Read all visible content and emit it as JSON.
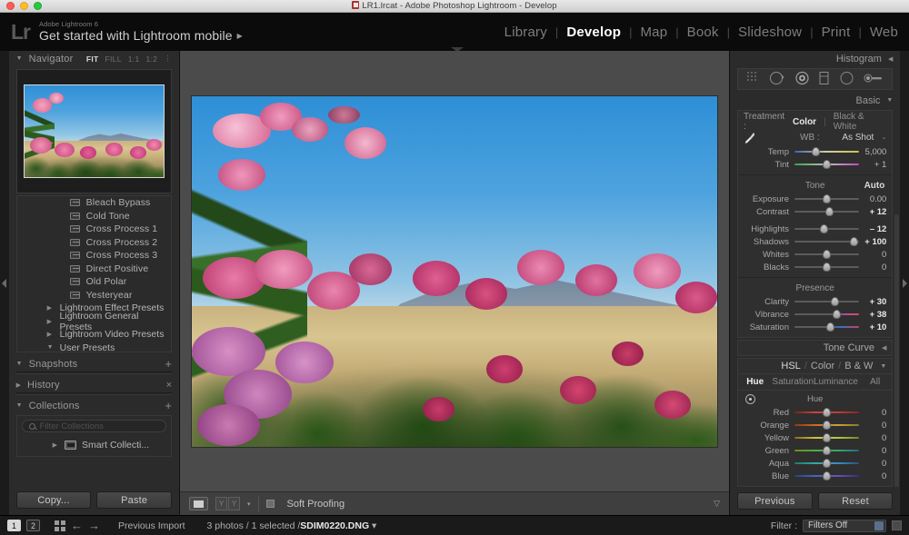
{
  "window": {
    "title": "LR1.lrcat - Adobe Photoshop Lightroom - Develop",
    "icon": "catalog-icon"
  },
  "identity": {
    "logo": "Lr",
    "sub_label": "Adobe Lightroom 6",
    "main_label": "Get started with Lightroom mobile",
    "arrow": "▶"
  },
  "modules": [
    {
      "label": "Library",
      "active": false
    },
    {
      "label": "Develop",
      "active": true
    },
    {
      "label": "Map",
      "active": false
    },
    {
      "label": "Book",
      "active": false
    },
    {
      "label": "Slideshow",
      "active": false
    },
    {
      "label": "Print",
      "active": false
    },
    {
      "label": "Web",
      "active": false
    }
  ],
  "left_panel": {
    "navigator": {
      "title": "Navigator",
      "twisty": "▼",
      "zoom_options": [
        "FIT",
        "FILL",
        "1:1",
        "1:2"
      ],
      "active_zoom": "FIT"
    },
    "presets": {
      "items": [
        "Bleach Bypass",
        "Cold Tone",
        "Cross Process 1",
        "Cross Process 2",
        "Cross Process 3",
        "Direct Positive",
        "Old Polar",
        "Yesteryear"
      ],
      "groups": [
        {
          "label": "Lightroom Effect Presets",
          "twisty": "▶"
        },
        {
          "label": "Lightroom General Presets",
          "twisty": "▶"
        },
        {
          "label": "Lightroom Video Presets",
          "twisty": "▶"
        },
        {
          "label": "User Presets",
          "twisty": "▼"
        }
      ]
    },
    "snapshots": {
      "title": "Snapshots",
      "twisty": "▼",
      "add": "+"
    },
    "history": {
      "title": "History",
      "twisty": "▶",
      "clear": "×"
    },
    "collections": {
      "title": "Collections",
      "twisty": "▼",
      "add": "+",
      "filter_placeholder": "Filter Collections",
      "items": [
        {
          "label": "Smart Collecti...",
          "twisty": "▶"
        }
      ]
    },
    "buttons": {
      "copy": "Copy...",
      "paste": "Paste"
    }
  },
  "toolbar": {
    "view_icon": "loupe-view-icon",
    "before_after_icon": "before-after-icon",
    "caret": "▾",
    "soft_proofing_label": "Soft Proofing",
    "soft_proofing_checked": false,
    "toggle_caret": "▽"
  },
  "right_panel": {
    "histogram": {
      "title": "Histogram",
      "twisty": "◀"
    },
    "tools": [
      "crop-overlay-icon",
      "spot-removal-icon",
      "red-eye-icon",
      "graduated-filter-icon",
      "radial-filter-icon",
      "adjustment-brush-icon"
    ],
    "basic": {
      "title": "Basic",
      "twisty": "▼",
      "treatment_label": "Treatment :",
      "treatment_options": [
        "Color",
        "Black & White"
      ],
      "treatment_active": "Color",
      "wb_label": "WB :",
      "wb_value": "As Shot",
      "wb_caret": "⌄",
      "white_balance_sliders": [
        {
          "label": "Temp",
          "value": "5,000",
          "pos": 33,
          "bold": false
        },
        {
          "label": "Tint",
          "value": "+ 1",
          "pos": 50,
          "bold": false
        }
      ],
      "tone_title": "Tone",
      "auto_label": "Auto",
      "tone_sliders": [
        {
          "label": "Exposure",
          "value": "0.00",
          "pos": 50,
          "bold": false
        },
        {
          "label": "Contrast",
          "value": "+ 12",
          "pos": 54,
          "bold": true
        },
        {
          "label": "Highlights",
          "value": "– 12",
          "pos": 45,
          "bold": true
        },
        {
          "label": "Shadows",
          "value": "+ 100",
          "pos": 92,
          "bold": true
        },
        {
          "label": "Whites",
          "value": "0",
          "pos": 50,
          "bold": false
        },
        {
          "label": "Blacks",
          "value": "0",
          "pos": 50,
          "bold": false
        }
      ],
      "presence_title": "Presence",
      "presence_sliders": [
        {
          "label": "Clarity",
          "value": "+ 30",
          "pos": 62,
          "bold": true
        },
        {
          "label": "Vibrance",
          "value": "+ 38",
          "pos": 65,
          "bold": true
        },
        {
          "label": "Saturation",
          "value": "+ 10",
          "pos": 56,
          "bold": true
        }
      ]
    },
    "tone_curve": {
      "title": "Tone Curve",
      "twisty": "◀"
    },
    "hsl": {
      "title_hsl": "HSL",
      "title_color": "Color",
      "title_bw": "B & W",
      "sep": "/",
      "twisty": "▼",
      "tabs": [
        "Hue",
        "Saturation",
        "Luminance",
        "All"
      ],
      "active_tab": "Hue",
      "section_label": "Hue",
      "target_icon": "target-adjust-icon",
      "sliders": [
        {
          "label": "Red",
          "value": "0",
          "pos": 50,
          "grad": "grad-red"
        },
        {
          "label": "Orange",
          "value": "0",
          "pos": 50,
          "grad": "grad-orange"
        },
        {
          "label": "Yellow",
          "value": "0",
          "pos": 50,
          "grad": "grad-yellow"
        },
        {
          "label": "Green",
          "value": "0",
          "pos": 50,
          "grad": "grad-green"
        },
        {
          "label": "Aqua",
          "value": "0",
          "pos": 50,
          "grad": "grad-aqua"
        },
        {
          "label": "Blue",
          "value": "0",
          "pos": 50,
          "grad": "grad-blue"
        }
      ]
    },
    "buttons": {
      "previous": "Previous",
      "reset": "Reset"
    }
  },
  "statusbar": {
    "page_1": "1",
    "page_2": "2",
    "grid_icon": "grid-view-icon",
    "back_arrow": "←",
    "forward_arrow": "→",
    "source_label": "Previous Import",
    "selection_text": "3 photos / 1 selected /",
    "filename": "SDIM0220.DNG",
    "filename_caret": "▾",
    "filter_label": "Filter :",
    "filter_value": "Filters Off"
  },
  "photo": {
    "alt_description": "Pink oleander flowers against blue sky with distant mountains and dry field"
  },
  "colors": {
    "panel_bg": "#2b2b2b",
    "canvas_bg": "#4b4b4b",
    "accent_white": "#ffffff",
    "text_dim": "#9a9a9a"
  }
}
